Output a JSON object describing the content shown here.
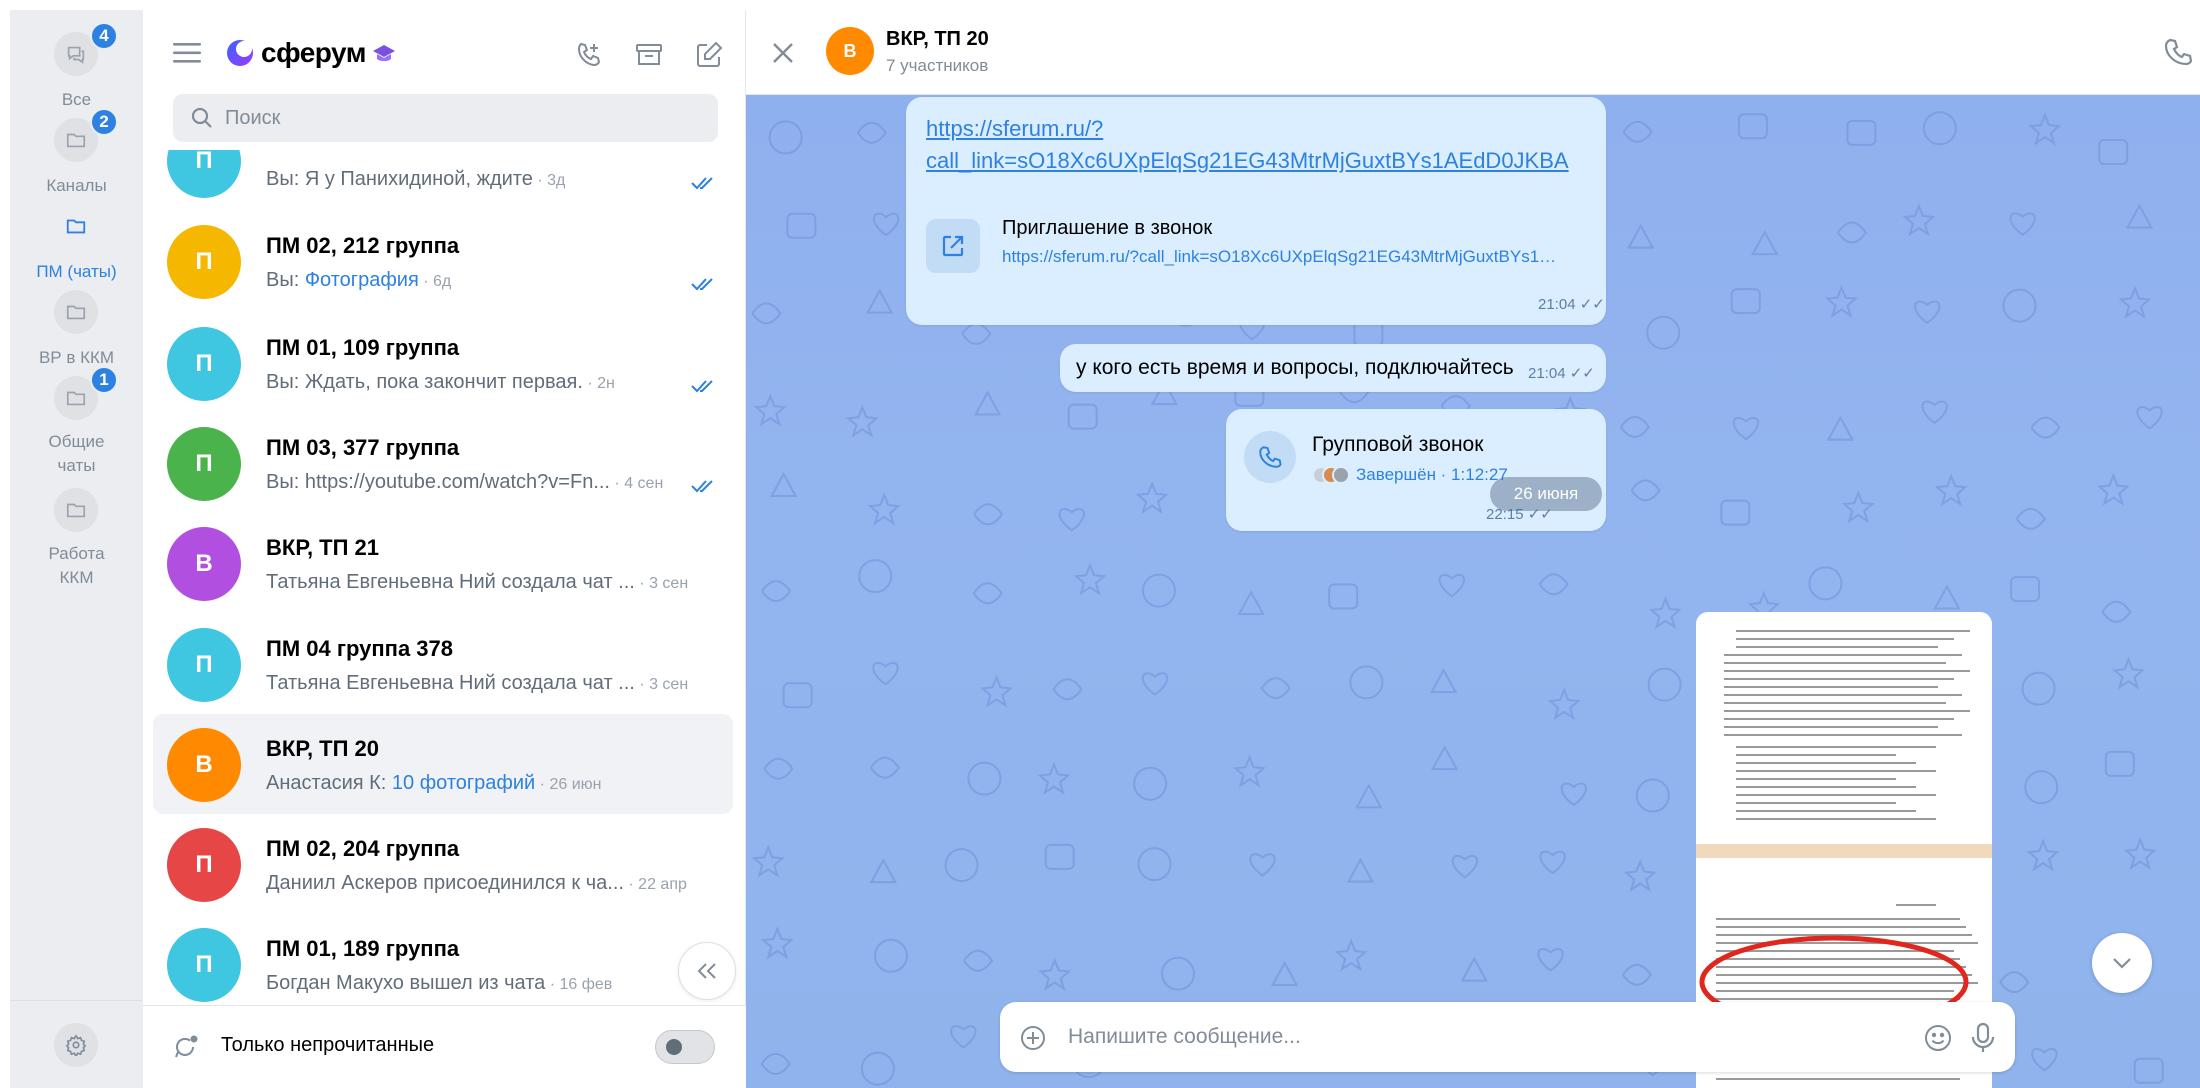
{
  "rail": {
    "items": [
      {
        "label": "Все",
        "badge": "4"
      },
      {
        "label": "Каналы",
        "badge": "2"
      },
      {
        "label": "ПМ (чаты)",
        "badge": ""
      },
      {
        "label": "ВР в ККМ",
        "badge": ""
      },
      {
        "label_line1": "Общие",
        "label_line2": "чаты",
        "badge": "1"
      },
      {
        "label_line1": "Работа",
        "label_line2": "ККМ",
        "badge": ""
      }
    ]
  },
  "header": {
    "app_name": "сферум"
  },
  "search": {
    "placeholder": "Поиск"
  },
  "chats": [
    {
      "initial": "П",
      "color": "#3fc6e0",
      "title": "",
      "sender": "Вы: ",
      "text": "Я у Панихидиной, ждите",
      "highlight": "",
      "time": "3д",
      "read": true
    },
    {
      "initial": "П",
      "color": "#f5b700",
      "title": "ПМ 02, 212 группа",
      "sender": "Вы: ",
      "text": "",
      "highlight": "Фотография",
      "time": "6д",
      "read": true
    },
    {
      "initial": "П",
      "color": "#3fc6e0",
      "title": "ПМ 01, 109 группа",
      "sender": "Вы: ",
      "text": "Ждать, пока закончит первая.",
      "highlight": "",
      "time": "2н",
      "read": true
    },
    {
      "initial": "П",
      "color": "#4bb34b",
      "title": "ПМ 03, 377 группа",
      "sender": "Вы: ",
      "text": "https://youtube.com/watch?v=Fn...",
      "highlight": "",
      "time": "4 сен",
      "read": true
    },
    {
      "initial": "В",
      "color": "#b14fe0",
      "title": "ВКР, ТП 21",
      "sender": "",
      "text": "Татьяна Евгеньевна Ний создала чат ...",
      "highlight": "",
      "time": "3 сен",
      "read": false
    },
    {
      "initial": "П",
      "color": "#3fc6e0",
      "title": "ПМ 04 группа 378",
      "sender": "",
      "text": "Татьяна Евгеньевна Ний создала чат ...",
      "highlight": "",
      "time": "3 сен",
      "read": false
    },
    {
      "initial": "В",
      "color": "#ff8a00",
      "title": "ВКР, ТП 20",
      "sender": "Анастасия К: ",
      "text": "",
      "highlight": "10 фотографий",
      "time": "26 июн",
      "read": false
    },
    {
      "initial": "П",
      "color": "#e64646",
      "title": "ПМ 02, 204 группа",
      "sender": "",
      "text": "Даниил Аскеров присоединился к ча...",
      "highlight": "",
      "time": "22 апр",
      "read": false
    },
    {
      "initial": "П",
      "color": "#3fc6e0",
      "title": "ПМ 01, 189 группа",
      "sender": "",
      "text": "Богдан Макухо вышел из чата",
      "highlight": "",
      "time": "16 фев",
      "read": false
    }
  ],
  "footer": {
    "unread_only_label": "Только непрочитанные"
  },
  "conversation": {
    "avatar_initial": "В",
    "title": "ВКР, ТП 20",
    "subtitle": "7 участников",
    "link_message": {
      "url_line1": "https://sferum.ru/?",
      "url_line2": "call_link=sO18Xc6UXpElqSg21EG43MtrMjGuxtBYs1AEdD0JKBA",
      "card_title": "Приглашение в звонок",
      "card_url": "https://sferum.ru/?call_link=sO18Xc6UXpElqSg21EG43MtrMjGuxtBYs1AEdD0JKBA",
      "time": "21:04"
    },
    "text_message": {
      "text": "у кого есть время и вопросы, подключайтесь",
      "time": "21:04"
    },
    "call_message": {
      "title": "Групповой звонок",
      "status": "Завершён · 1:12:27",
      "time": "22:15"
    },
    "date_divider": "26 июня",
    "composer_placeholder": "Напишите сообщение..."
  },
  "colors": {
    "accent": "#2d81e0",
    "chat_background": "#8fb0ee",
    "outgoing_bubble": "#dbeeff",
    "annotation_red": "#e0261d"
  }
}
